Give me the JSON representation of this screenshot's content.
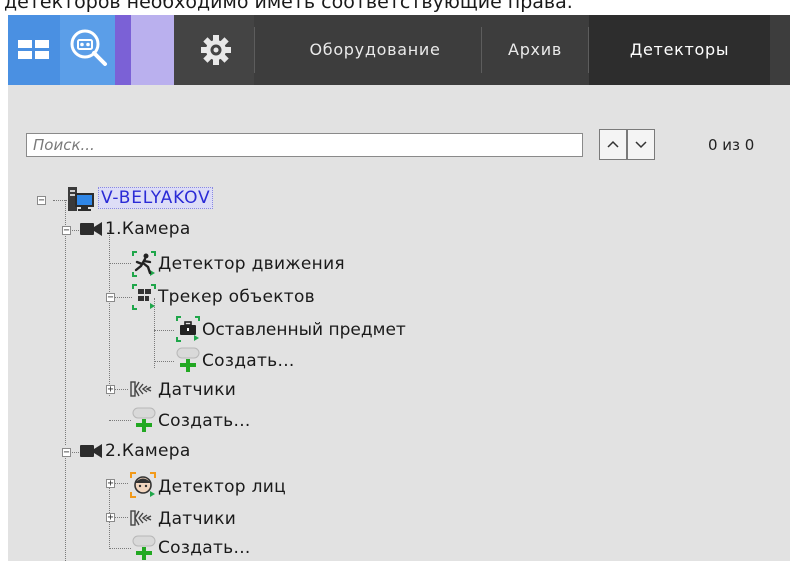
{
  "caption": "детекторов необходимо иметь соответствующие права.",
  "toolbar": {
    "icons": [
      "windows-icon",
      "search-video-icon",
      "gear-icon"
    ],
    "tabs": [
      {
        "label": "Оборудование"
      },
      {
        "label": "Архив"
      },
      {
        "label": "Детекторы",
        "active": true
      }
    ]
  },
  "search": {
    "placeholder": "Поиск...",
    "value": "",
    "up_label": "^",
    "down_label": "v",
    "counter": "0 из 0"
  },
  "tree": {
    "server": "V-BELYAKOV",
    "camera1": {
      "label": "1.Камера",
      "motion_detector": "Детектор движения",
      "object_tracker": "Трекер объектов",
      "abandoned_object": "Оставленный предмет",
      "create_in_tracker": "Создать...",
      "sensors": "Датчики",
      "create": "Создать..."
    },
    "camera2": {
      "label": "2.Камера",
      "face_detector": "Детектор лиц",
      "sensors": "Датчики",
      "create": "Создать..."
    }
  },
  "colors": {
    "toolbar_bg": "#3d3d3d",
    "active_tab_bg": "#2d2d2d",
    "windows_tile": "#4a90e2",
    "search_tile": "#5b9ee8",
    "panel_bg": "#e2e2e2",
    "selection_text": "#2b2bd6",
    "create_plus": "#22a822",
    "detector_bracket": "#1fa64a"
  }
}
